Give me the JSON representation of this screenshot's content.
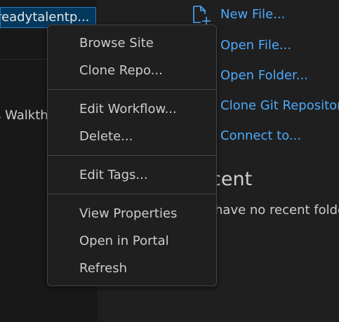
{
  "sidebar": {
    "selected_item": "readytalentp...",
    "walkthrough_text": "s Walkth"
  },
  "start": {
    "links": [
      "New File...",
      "Open File...",
      "Open Folder...",
      "Clone Git Repository",
      "Connect to..."
    ]
  },
  "recent": {
    "heading": "cent",
    "text": "have no recent folde"
  },
  "context_menu": {
    "items": [
      "Browse Site",
      "Clone Repo...",
      "Edit Workflow...",
      "Delete...",
      "Edit Tags...",
      "View Properties",
      "Open in Portal",
      "Refresh"
    ]
  },
  "colors": {
    "accent_link": "#4daafc",
    "selection_bg": "#04395e",
    "menu_bg": "#1f1f1f"
  },
  "icons": {
    "new_file": "new-file-icon"
  }
}
